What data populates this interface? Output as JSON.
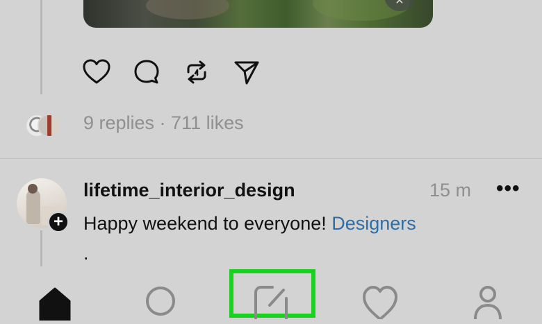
{
  "post": {
    "actions": {
      "like_icon": "heart-icon",
      "comment_icon": "comment-icon",
      "repost_icon": "repost-icon",
      "share_icon": "send-icon"
    },
    "stats": "9 replies · 711 likes"
  },
  "next_post": {
    "username": "lifetime_interior_design",
    "time": "15 m",
    "more": "•••",
    "follow_symbol": "+",
    "text": "Happy weekend to everyone! ",
    "hashtag": "Designers",
    "continuation": "."
  },
  "bottom_nav": {
    "items": [
      "home-icon",
      "search-icon",
      "compose-icon",
      "heart-icon",
      "profile-icon"
    ],
    "highlight_color": "#19d11f"
  },
  "colors": {
    "background": "#d3d3d3",
    "muted_text": "#8f8f8f",
    "link": "#2f6ea5"
  }
}
